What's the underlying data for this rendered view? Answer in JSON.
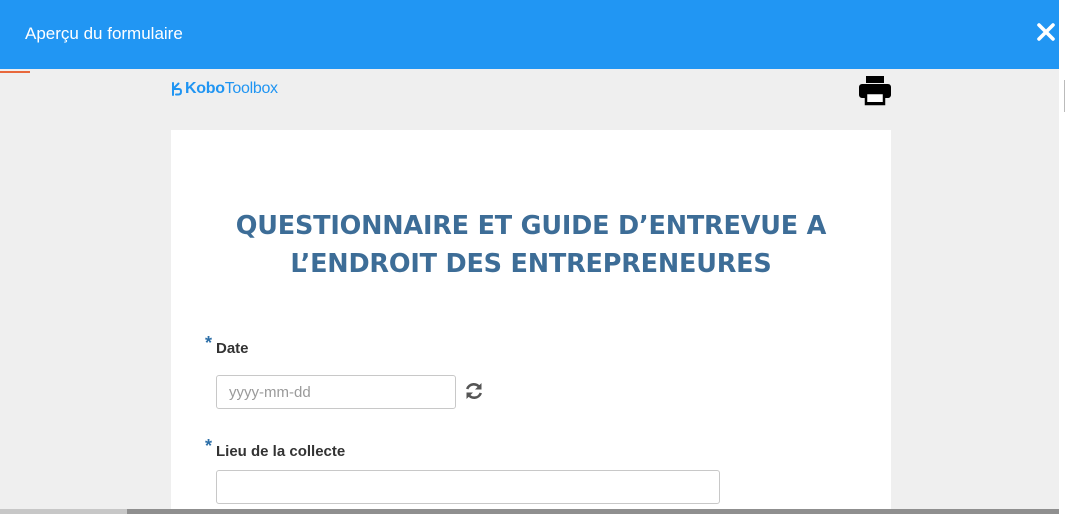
{
  "modal": {
    "title": "Aperçu du formulaire",
    "close_icon": "close-icon",
    "header_color": "#2196f3"
  },
  "logo": {
    "prefix": "Kobo",
    "suffix": "Toolbox",
    "color": "#2095f2"
  },
  "toolbar": {
    "print_icon": "printer-icon"
  },
  "form": {
    "title_line1": "QUESTIONNAIRE ET GUIDE D’ENTREVUE A",
    "title_line2": "L’ENDROIT DES ENTREPRENEURES",
    "title_color": "#3d6d97",
    "fields": [
      {
        "required_mark": "*",
        "label": "Date",
        "value": "",
        "placeholder": "yyyy-mm-dd",
        "action_icon": "refresh-icon"
      },
      {
        "required_mark": "*",
        "label": "Lieu de la collecte",
        "value": "",
        "placeholder": ""
      }
    ]
  }
}
